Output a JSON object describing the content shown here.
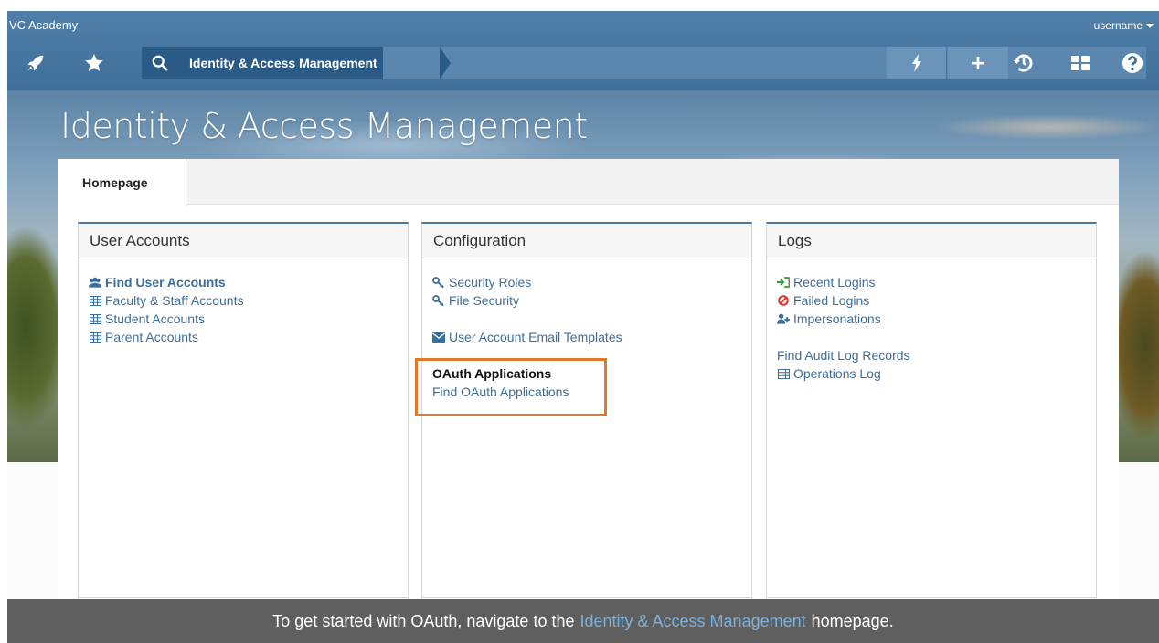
{
  "header": {
    "org_name": "VC Academy",
    "username": "username",
    "breadcrumb": "Identity & Access Management"
  },
  "page": {
    "title": "Identity & Access Management",
    "tabs": [
      {
        "label": "Homepage"
      }
    ]
  },
  "panels": {
    "user_accounts": {
      "title": "User Accounts",
      "items": [
        {
          "label": "Find User Accounts"
        },
        {
          "label": "Faculty & Staff Accounts"
        },
        {
          "label": "Student Accounts"
        },
        {
          "label": "Parent Accounts"
        }
      ]
    },
    "configuration": {
      "title": "Configuration",
      "items": [
        {
          "label": "Security Roles"
        },
        {
          "label": "File Security"
        },
        {
          "label": "User Account Email Templates"
        }
      ],
      "oauth_heading": "OAuth Applications",
      "oauth_link": "Find OAuth Applications"
    },
    "logs": {
      "title": "Logs",
      "items": [
        {
          "label": "Recent Logins"
        },
        {
          "label": "Failed Logins"
        },
        {
          "label": "Impersonations"
        },
        {
          "label": "Find Audit Log Records"
        },
        {
          "label": "Operations Log"
        }
      ]
    }
  },
  "caption": {
    "before": "To get started with OAuth, navigate to the",
    "link": "Identity & Access Management",
    "after": "homepage."
  },
  "colors": {
    "header_blue": "#4f7fa8",
    "link_blue": "#3b6e9a",
    "highlight_orange": "#e07a2a",
    "failed_red": "#d9362b",
    "recent_green": "#3a9a3a"
  }
}
